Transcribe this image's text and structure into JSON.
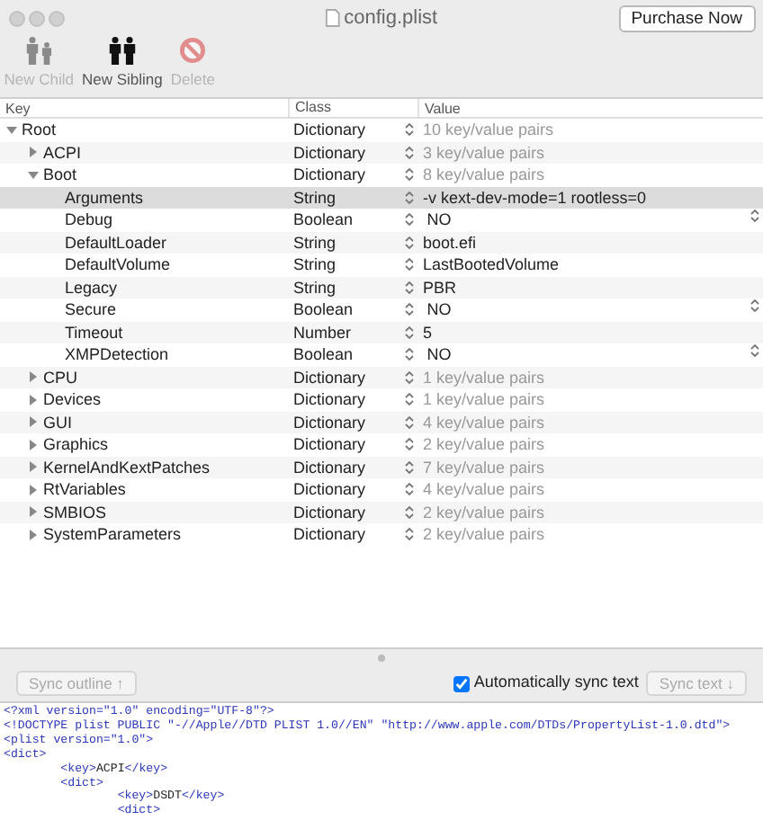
{
  "window": {
    "title": "config.plist",
    "purchase_button": "Purchase Now"
  },
  "toolbar": [
    {
      "kind": "child",
      "label": "New Child",
      "disabled": true
    },
    {
      "kind": "sibling",
      "label": "New Sibling",
      "disabled": false
    },
    {
      "kind": "delete",
      "label": "Delete",
      "disabled": true
    }
  ],
  "outline": {
    "columns": [
      "Key",
      "Class",
      "Value"
    ],
    "rows": [
      {
        "key": "Root",
        "class": "Dictionary",
        "value": "10 key/value pairs",
        "kind": "dictionary",
        "expanded": true,
        "selected": false,
        "children": [
          {
            "key": "ACPI",
            "class": "Dictionary",
            "value": "3 key/value pairs",
            "kind": "dictionary",
            "expanded": false,
            "selected": false
          },
          {
            "key": "Boot",
            "class": "Dictionary",
            "value": "8 key/value pairs",
            "kind": "dictionary",
            "expanded": true,
            "selected": false,
            "children": [
              {
                "key": "Arguments",
                "class": "String",
                "value": "-v kext-dev-mode=1 rootless=0",
                "kind": "string",
                "selected": true
              },
              {
                "key": "Debug",
                "class": "Boolean",
                "value": "NO",
                "kind": "boolean",
                "selected": false
              },
              {
                "key": "DefaultLoader",
                "class": "String",
                "value": "boot.efi",
                "kind": "string",
                "selected": false
              },
              {
                "key": "DefaultVolume",
                "class": "String",
                "value": "LastBootedVolume",
                "kind": "string",
                "selected": false
              },
              {
                "key": "Legacy",
                "class": "String",
                "value": "PBR",
                "kind": "string",
                "selected": false
              },
              {
                "key": "Secure",
                "class": "Boolean",
                "value": "NO",
                "kind": "boolean",
                "selected": false
              },
              {
                "key": "Timeout",
                "class": "Number",
                "value": "5",
                "kind": "number",
                "selected": false
              },
              {
                "key": "XMPDetection",
                "class": "Boolean",
                "value": "NO",
                "kind": "boolean",
                "selected": false
              }
            ]
          },
          {
            "key": "CPU",
            "class": "Dictionary",
            "value": "1 key/value pairs",
            "kind": "dictionary",
            "expanded": false,
            "selected": false
          },
          {
            "key": "Devices",
            "class": "Dictionary",
            "value": "1 key/value pairs",
            "kind": "dictionary",
            "expanded": false,
            "selected": false
          },
          {
            "key": "GUI",
            "class": "Dictionary",
            "value": "4 key/value pairs",
            "kind": "dictionary",
            "expanded": false,
            "selected": false
          },
          {
            "key": "Graphics",
            "class": "Dictionary",
            "value": "2 key/value pairs",
            "kind": "dictionary",
            "expanded": false,
            "selected": false
          },
          {
            "key": "KernelAndKextPatches",
            "class": "Dictionary",
            "value": "7 key/value pairs",
            "kind": "dictionary",
            "expanded": false,
            "selected": false
          },
          {
            "key": "RtVariables",
            "class": "Dictionary",
            "value": "4 key/value pairs",
            "kind": "dictionary",
            "expanded": false,
            "selected": false
          },
          {
            "key": "SMBIOS",
            "class": "Dictionary",
            "value": "2 key/value pairs",
            "kind": "dictionary",
            "expanded": false,
            "selected": false
          },
          {
            "key": "SystemParameters",
            "class": "Dictionary",
            "value": "2 key/value pairs",
            "kind": "dictionary",
            "expanded": false,
            "selected": false
          }
        ]
      }
    ]
  },
  "sync_bar": {
    "sync_outline": {
      "label": "Sync outline ↑",
      "disabled": true
    },
    "auto_sync": {
      "label": "Automatically sync text",
      "checked": true
    },
    "sync_text": {
      "label": "Sync text ↓",
      "disabled": true
    }
  },
  "xml_text": [
    "<?xml version=\"1.0\" encoding=\"UTF-8\"?>",
    "<!DOCTYPE plist PUBLIC \"-//Apple//DTD PLIST 1.0//EN\" \"http://www.apple.com/DTDs/PropertyList-1.0.dtd\">",
    "<plist version=\"1.0\">",
    "<dict>",
    "        <key>ACPI</key>",
    "        <dict>",
    "                <key>DSDT</key>",
    "                <dict>"
  ]
}
